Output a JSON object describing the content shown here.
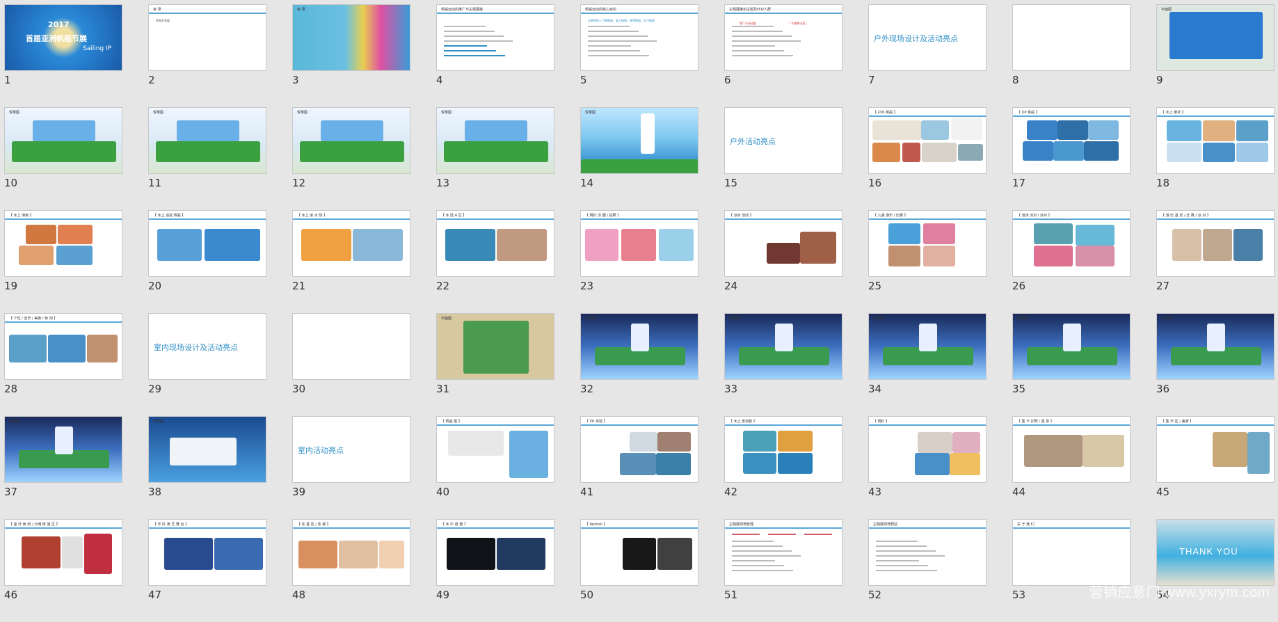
{
  "slides": [
    {
      "n": "1",
      "title": "2017",
      "subtitle": "首届亚洲帆船节展",
      "extra": "Sailing IP"
    },
    {
      "n": "2",
      "header": "目 录",
      "lines": [
        "帆船的发展"
      ]
    },
    {
      "n": "3",
      "header": "目 录"
    },
    {
      "n": "4",
      "header": "帆船运动的推广与主题展策"
    },
    {
      "n": "5",
      "header": "帆船运动的核心目的",
      "lines": [
        "让更多的人了解帆船，爱上帆船，享受帆船，学习帆船"
      ]
    },
    {
      "n": "6",
      "header": "主题展策划主题及针对人群",
      "lines": [
        "\"帆\" 乐动动起",
        "「 沙滩俱乐部 」"
      ]
    },
    {
      "n": "7",
      "big": "户外现场设计及活动亮点"
    },
    {
      "n": "8"
    },
    {
      "n": "9",
      "header": "平面图"
    },
    {
      "n": "10",
      "header": "效果图"
    },
    {
      "n": "11",
      "header": "效果图"
    },
    {
      "n": "12",
      "header": "效果图"
    },
    {
      "n": "13",
      "header": "效果图"
    },
    {
      "n": "14",
      "header": "效果图"
    },
    {
      "n": "15",
      "big": "户外活动亮点"
    },
    {
      "n": "16",
      "header": "【 户外 帆船 】"
    },
    {
      "n": "17",
      "header": "【 OP 帆船 】"
    },
    {
      "n": "18",
      "header": "【 水上 摩托 】"
    },
    {
      "n": "19",
      "header": "【 水上 滑板 】"
    },
    {
      "n": "20",
      "header": "【 水上 遥控 帆船 】"
    },
    {
      "n": "21",
      "header": "【 水上 滚 水 球 】"
    },
    {
      "n": "22",
      "header": "【 水 陆 A 区 】"
    },
    {
      "n": "23",
      "header": "【 网红 泳 圈 / 拍照 】"
    },
    {
      "n": "24",
      "header": "【 派对 活动 】"
    },
    {
      "n": "25",
      "header": "【 儿童 游乐 / 比赛 】"
    },
    {
      "n": "26",
      "header": "【 泡沫 派对 / 派对 】"
    },
    {
      "n": "27",
      "header": "【 游 比 基 尼 / 比 赛 / 派 对 】"
    },
    {
      "n": "28",
      "header": "【 个性 / 音乐 / 美食 / 休 闲 】"
    },
    {
      "n": "29",
      "big": "室内现场设计及活动亮点"
    },
    {
      "n": "30"
    },
    {
      "n": "31",
      "header": "平面图"
    },
    {
      "n": "32",
      "header": "效果图"
    },
    {
      "n": "33",
      "header": "效果图"
    },
    {
      "n": "34",
      "header": "效果图"
    },
    {
      "n": "35",
      "header": "效果图"
    },
    {
      "n": "36",
      "header": "效果图"
    },
    {
      "n": "37",
      "header": "效果图"
    },
    {
      "n": "38",
      "header": "效果图"
    },
    {
      "n": "39",
      "big": "室内活动亮点"
    },
    {
      "n": "40",
      "header": "【 帆船 展 】"
    },
    {
      "n": "41",
      "header": "【 VR 体验 】"
    },
    {
      "n": "42",
      "header": "【 水上 皮划艇 】"
    },
    {
      "n": "43",
      "header": "【 网红 】"
    },
    {
      "n": "44",
      "header": "【 集 卡 护照 / 集 章 】"
    },
    {
      "n": "45",
      "header": "【 集 市 区 / 美食 】"
    },
    {
      "n": "46",
      "header": "【 室 外 休 闲 / 沙滩 帐 篷 区 】"
    },
    {
      "n": "47",
      "header": "【 乐 队 演 艺 舞 台 】"
    },
    {
      "n": "48",
      "header": "【 比 基 尼 / 泳 装 】"
    },
    {
      "n": "49",
      "header": "【 水 中 芭 蕾 】"
    },
    {
      "n": "50",
      "header": "【 fashion 】"
    },
    {
      "n": "51",
      "header": "主题展现场管理"
    },
    {
      "n": "52",
      "header": "主题展现场预估"
    },
    {
      "n": "53",
      "header": "关 于 我 们"
    },
    {
      "n": "54",
      "big": "THANK YOU"
    }
  ],
  "watermark": "营销应意门 www.yxrym.com",
  "colors": {
    "background": "#e6e6e6",
    "accent": "#2f8fc8",
    "rule": "#5ba7d8"
  }
}
